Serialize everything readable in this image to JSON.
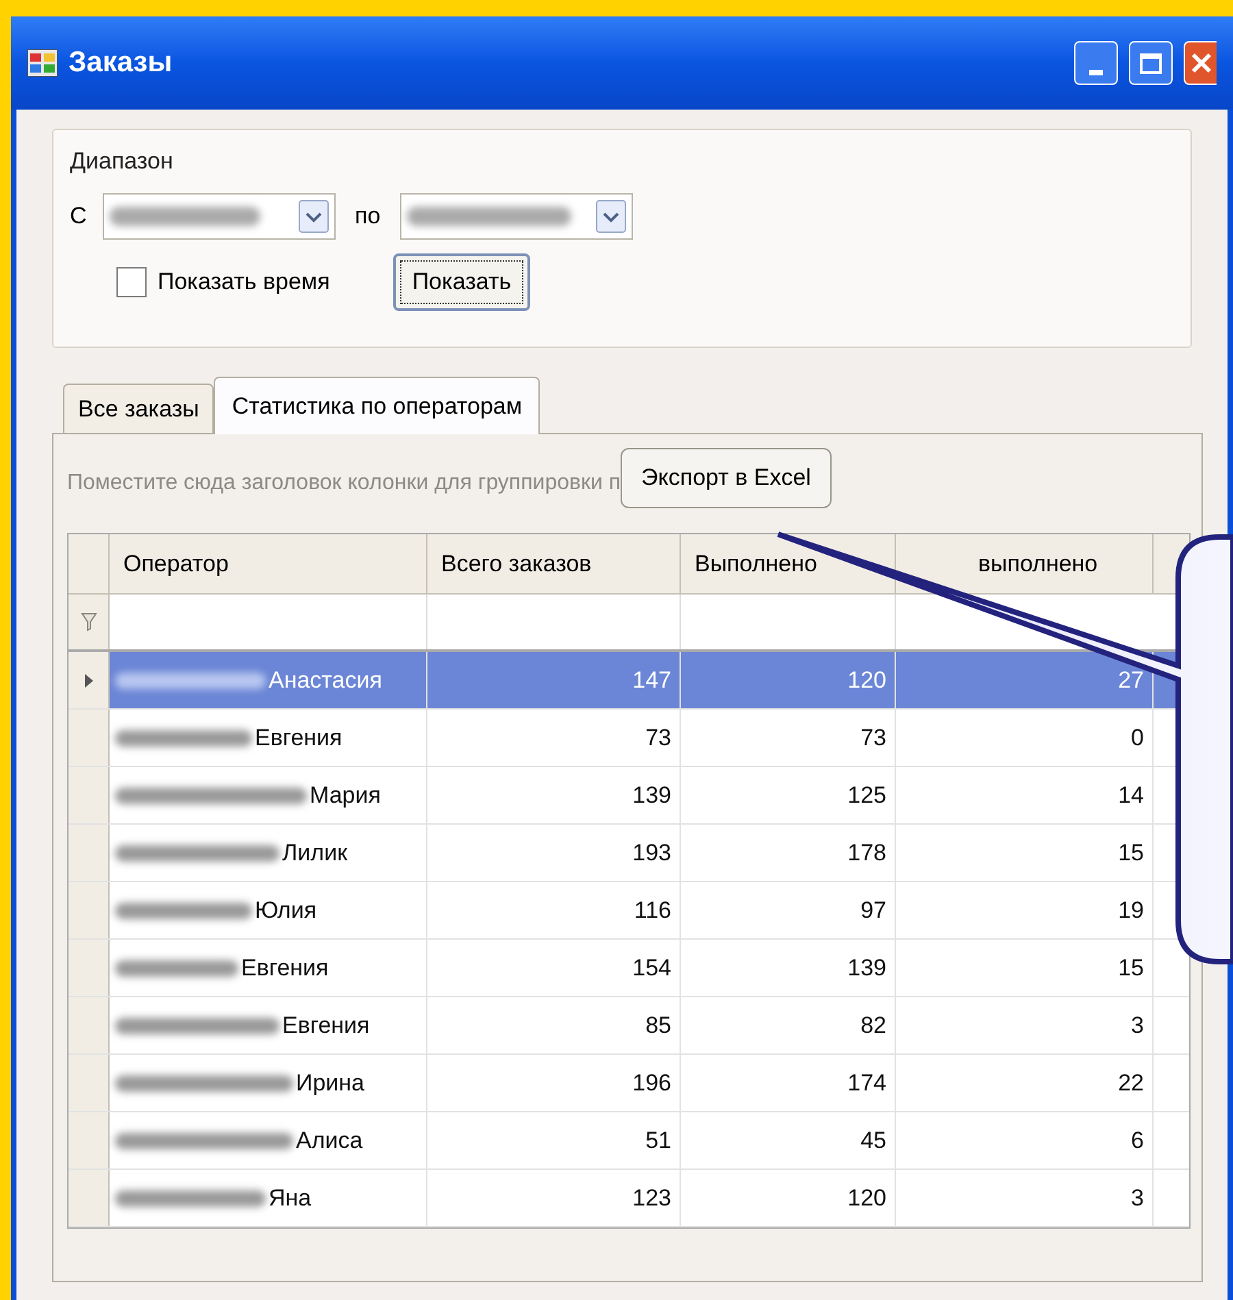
{
  "window": {
    "title": "Заказы"
  },
  "range": {
    "title": "Диапазон",
    "from_label": "С",
    "to_label": "по",
    "show_time": {
      "label": "Показать время",
      "checked": false
    },
    "show_button": "Показать"
  },
  "tabs": [
    {
      "label": "Все заказы",
      "selected": false
    },
    {
      "label": "Статистика по операторам",
      "selected": true
    }
  ],
  "group_hint": "Поместите сюда заголовок колонки для группировки п",
  "export_button": "Экспорт в Excel",
  "table": {
    "columns": [
      "Оператор",
      "Всего заказов",
      "Выполнено",
      "выполнено"
    ],
    "rows": [
      {
        "operator": "Анастасия",
        "total": "147",
        "done": "120",
        "not_done": "27",
        "selected": true
      },
      {
        "operator": "Евгения",
        "total": "73",
        "done": "73",
        "not_done": "0",
        "selected": false
      },
      {
        "operator": "Мария",
        "total": "139",
        "done": "125",
        "not_done": "14",
        "selected": false
      },
      {
        "operator": "Лилик",
        "total": "193",
        "done": "178",
        "not_done": "15",
        "selected": false
      },
      {
        "operator": "Юлия",
        "total": "116",
        "done": "97",
        "not_done": "19",
        "selected": false
      },
      {
        "operator": "Евгения",
        "total": "154",
        "done": "139",
        "not_done": "15",
        "selected": false
      },
      {
        "operator": "Евгения",
        "total": "85",
        "done": "82",
        "not_done": "3",
        "selected": false
      },
      {
        "operator": "Ирина",
        "total": "196",
        "done": "174",
        "not_done": "22",
        "selected": false
      },
      {
        "operator": "Алиса",
        "total": "51",
        "done": "45",
        "not_done": "6",
        "selected": false
      },
      {
        "operator": "Яна",
        "total": "123",
        "done": "120",
        "not_done": "3",
        "selected": false
      }
    ]
  }
}
